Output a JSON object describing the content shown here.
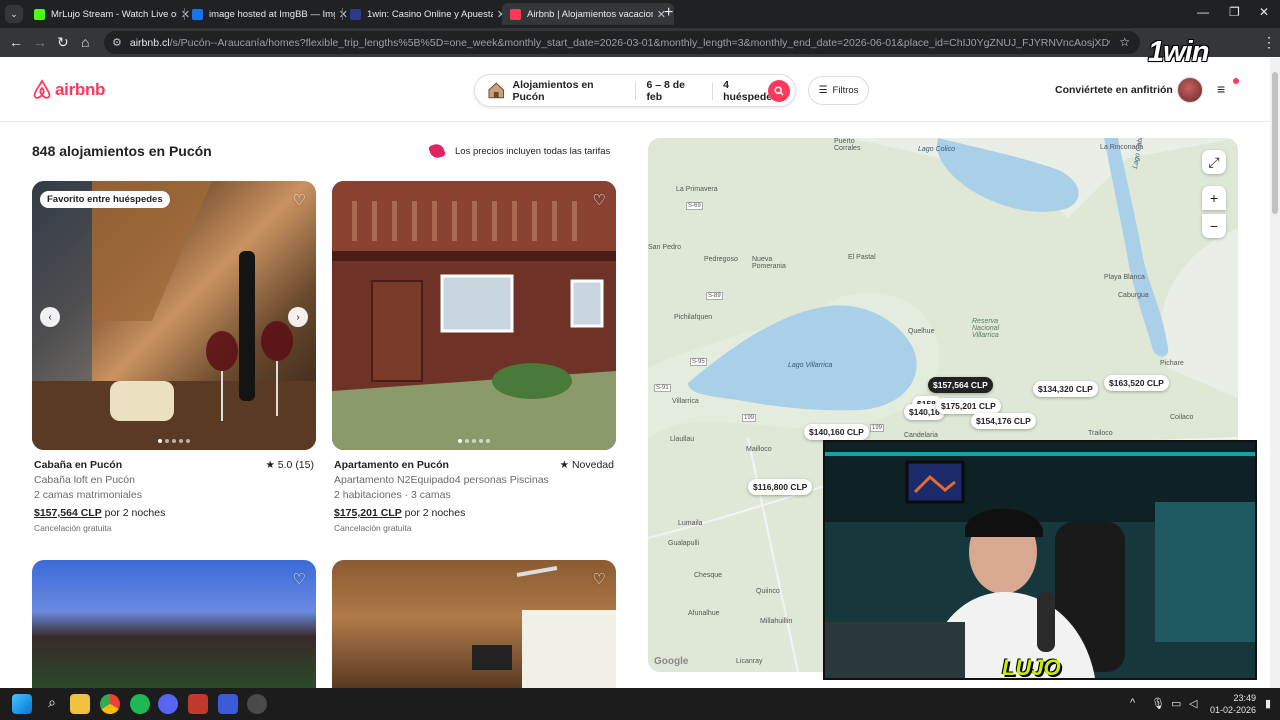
{
  "browser": {
    "tabs": [
      {
        "title": "MrLujo Stream - Watch Live on",
        "favicon_color": "#53fc18"
      },
      {
        "title": "image hosted at ImgBB — ImgBB",
        "favicon_color": "#1a73e8"
      },
      {
        "title": "1win: Casino Online y Apuestas",
        "favicon_color": "#2d3a8c"
      },
      {
        "title": "Airbnb | Alojamientos vacacionales",
        "favicon_color": "#ff385c"
      }
    ],
    "url_host": "airbnb.cl",
    "url_rest": "/s/Pucón--Araucanía/homes?flexible_trip_lengths%5B%5D=one_week&monthly_start_date=2026-03-01&monthly_length=3&monthly_end_date=2026-06-01&place_id=ChIJ0YgZNUJ_FJYRNVncAosjXDw&refinement_paths%5B%5..."
  },
  "header": {
    "logo": "airbnb",
    "search_location": "Alojamientos en Pucón",
    "search_dates": "6 – 8 de feb",
    "search_guests": "4 huéspedes",
    "filters": "Filtros",
    "host_link": "Conviértete en anfitrión",
    "brand_color": "#ff385c"
  },
  "results": {
    "count": "848 alojamientos en Pucón",
    "prices_note": "Los precios incluyen todas las tarifas"
  },
  "listings": [
    {
      "badge": "Favorito entre huéspedes",
      "title": "Cabaña en Pucón",
      "rating": "★ 5.0 (15)",
      "subtitle": "Cabaña loft en Pucón",
      "details": "2 camas matrimoniales",
      "price": "$157,564 CLP",
      "price_suffix": " por 2 noches",
      "cancellation": "Cancelación gratuita"
    },
    {
      "title": "Apartamento en Pucón",
      "rating": "★ Novedad",
      "subtitle": "Apartamento N2Equipado4 personas Piscinas",
      "details": "2 habitaciones · 3 camas",
      "price": "$175,201 CLP",
      "price_suffix": " por 2 noches",
      "cancellation": "Cancelación gratuita"
    }
  ],
  "map": {
    "places": {
      "puerto_corrales": "Puerto\nCorrales",
      "la_rinconada": "La Rinconada",
      "lago_colico": "Lago Colico",
      "la_primavera": "La Primavera",
      "san_pedro": "San Pedro",
      "pedregoso": "Pedregoso",
      "nueva_pomerania": "Nueva\nPomerania",
      "el_pastal": "El Pastal",
      "pichilafquen": "Pichilafquen",
      "playa_blanca": "Playa Blanca",
      "caburgua": "Caburgua",
      "quelhue": "Quelhue",
      "reserva": "Reserva\nNacional\nVillarrica",
      "lago_villarrica": "Lago Villarrica",
      "lago_caburgua": "Lago Caburgua",
      "pichare": "Pichare",
      "villarrica": "Villarrica",
      "llaullau": "Llaullau",
      "candelaria": "Candelaria",
      "mailloco": "Mailloco",
      "trailoco": "Trailoco",
      "coilaco": "Coilaco",
      "lumaila": "Lumaila",
      "gualapulli": "Gualapulli",
      "chesque": "Chesque",
      "quiinco": "Quiinco",
      "afunalhue": "Afunalhue",
      "millahuillin": "Millahuillin",
      "licanray": "Licanray",
      "road_s69": "S-69",
      "road_s89": "S-89",
      "road_s95": "S-95",
      "road_s91": "S-91",
      "road_199a": "199",
      "road_199b": "199"
    },
    "pins": {
      "p1": "$157,564 CLP",
      "p2": "$134,320 CLP",
      "p3": "$163,520 CLP",
      "p4": "$158,",
      "p5": "$175,201 CLP",
      "p6": "$140,16",
      "p7": "$154,176 CLP",
      "p8": "$140,160 CLP",
      "p9": "$116,800 CLP"
    },
    "attribution": "Google"
  },
  "stream": {
    "overlay_logo": "1win",
    "cam_logo": "LUJO"
  },
  "taskbar": {
    "time": "23:49",
    "date": "01-02-2026"
  }
}
